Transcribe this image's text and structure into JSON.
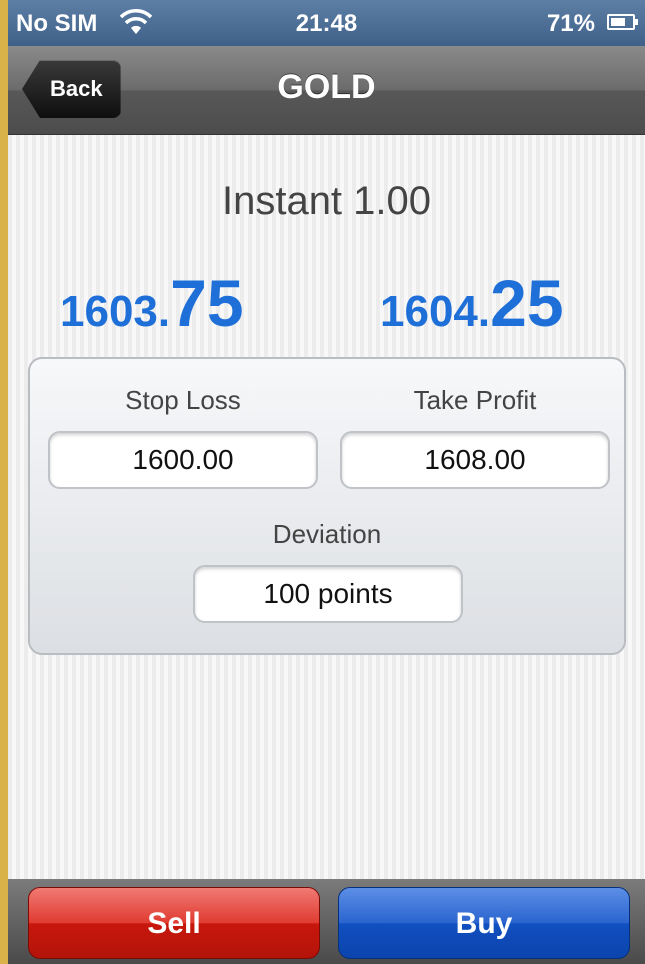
{
  "status_bar": {
    "carrier": "No SIM",
    "time": "21:48",
    "battery_pct": "71%",
    "battery_level": 0.71,
    "icons": [
      "wifi-icon",
      "battery-icon"
    ]
  },
  "nav": {
    "back_label": "Back",
    "title": "GOLD"
  },
  "order": {
    "type_label": "Instant 1.00",
    "bid": {
      "prefix": "1603.",
      "main": "75"
    },
    "ask": {
      "prefix": "1604.",
      "main": "25"
    }
  },
  "panel": {
    "stop_loss_label": "Stop Loss",
    "stop_loss_value": "1600.00",
    "take_profit_label": "Take Profit",
    "take_profit_value": "1608.00",
    "deviation_label": "Deviation",
    "deviation_value": "100 points"
  },
  "actions": {
    "sell_label": "Sell",
    "buy_label": "Buy"
  },
  "colors": {
    "price": "#1e6fd8",
    "sell": "#d9261b",
    "buy": "#1f5ccc",
    "status_bar": "#4a6c94",
    "background_frame": "#d9b24a"
  }
}
